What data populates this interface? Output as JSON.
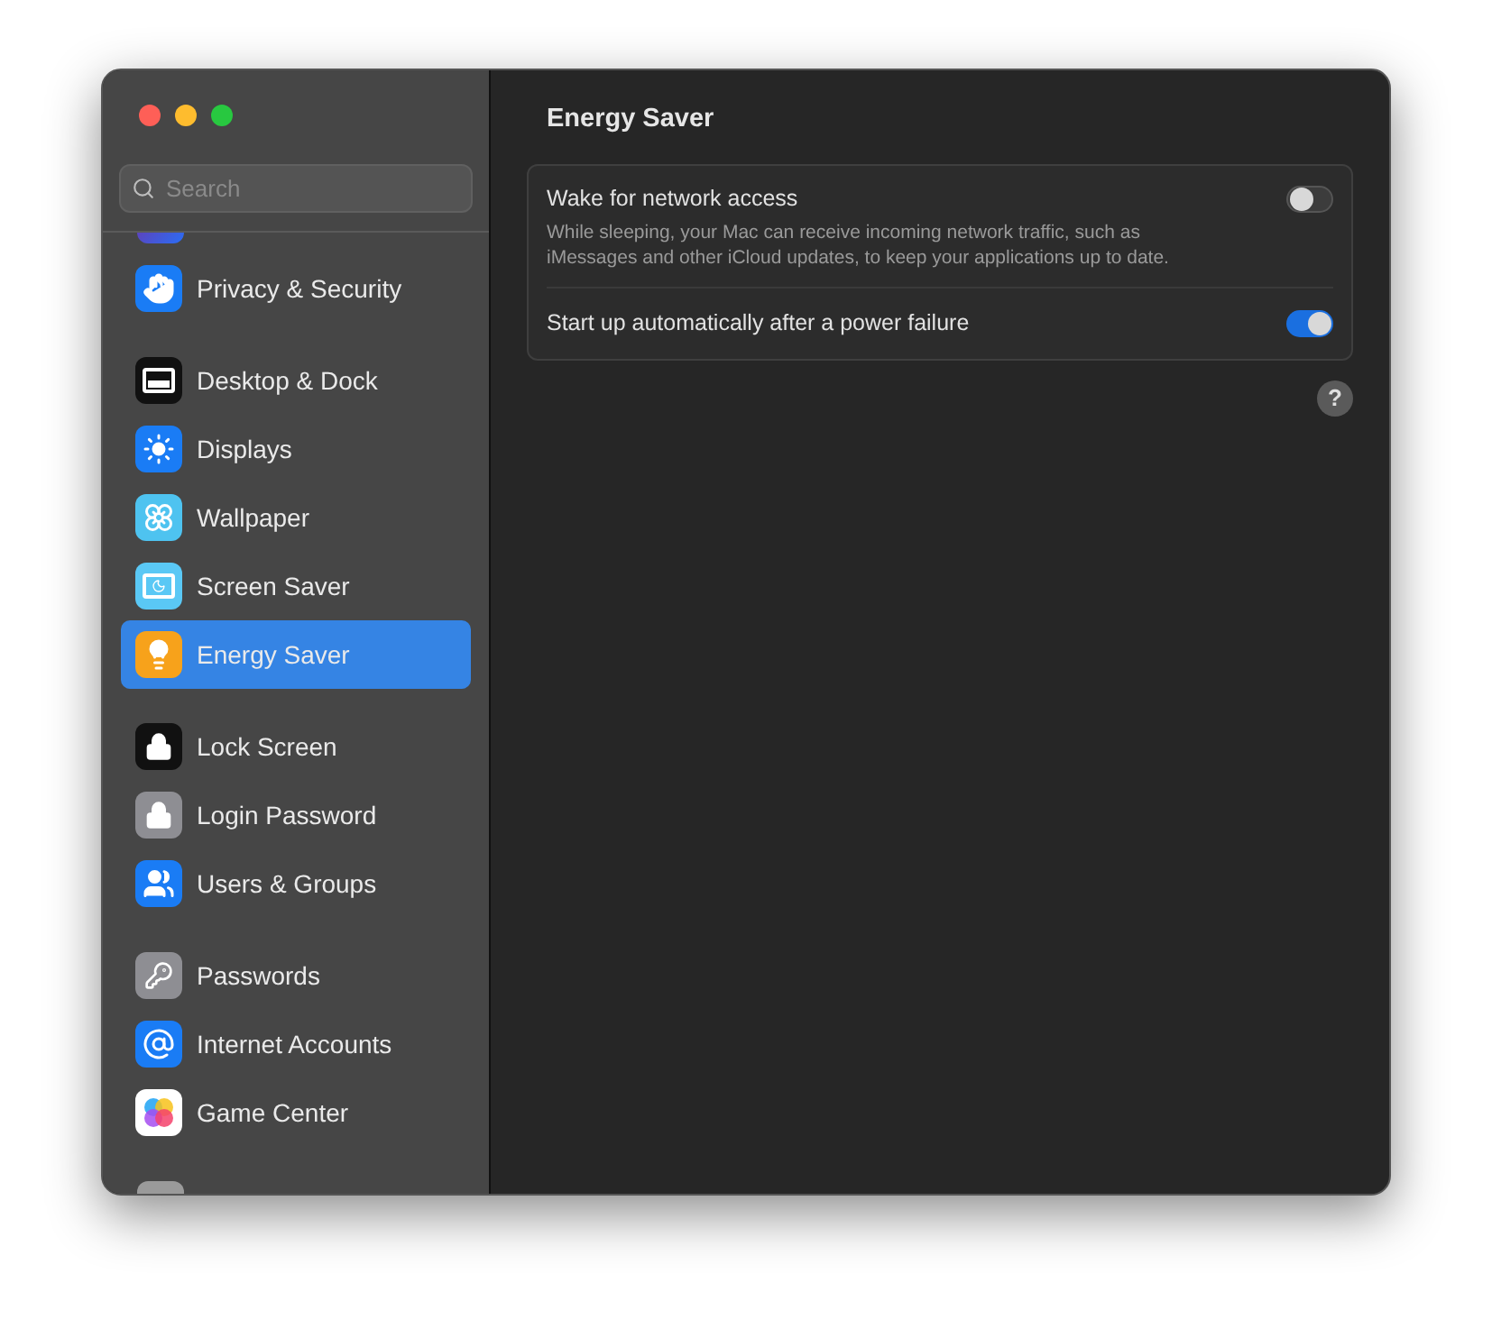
{
  "search": {
    "placeholder": "Search"
  },
  "sidebar": {
    "groups": [
      {
        "items": [
          {
            "label": "Privacy & Security",
            "selected": false
          }
        ]
      },
      {
        "items": [
          {
            "label": "Desktop & Dock",
            "selected": false
          },
          {
            "label": "Displays",
            "selected": false
          },
          {
            "label": "Wallpaper",
            "selected": false
          },
          {
            "label": "Screen Saver",
            "selected": false
          },
          {
            "label": "Energy Saver",
            "selected": true
          }
        ]
      },
      {
        "items": [
          {
            "label": "Lock Screen",
            "selected": false
          },
          {
            "label": "Login Password",
            "selected": false
          },
          {
            "label": "Users & Groups",
            "selected": false
          }
        ]
      },
      {
        "items": [
          {
            "label": "Passwords",
            "selected": false
          },
          {
            "label": "Internet Accounts",
            "selected": false
          },
          {
            "label": "Game Center",
            "selected": false
          }
        ]
      }
    ]
  },
  "content": {
    "title": "Energy Saver",
    "settings": [
      {
        "label": "Wake for network access",
        "description": "While sleeping, your Mac can receive incoming network traffic, such as iMessages and other iCloud updates, to keep your applications up to date.",
        "on": false
      },
      {
        "label": "Start up automatically after a power failure",
        "on": true
      }
    ],
    "help": "?"
  }
}
